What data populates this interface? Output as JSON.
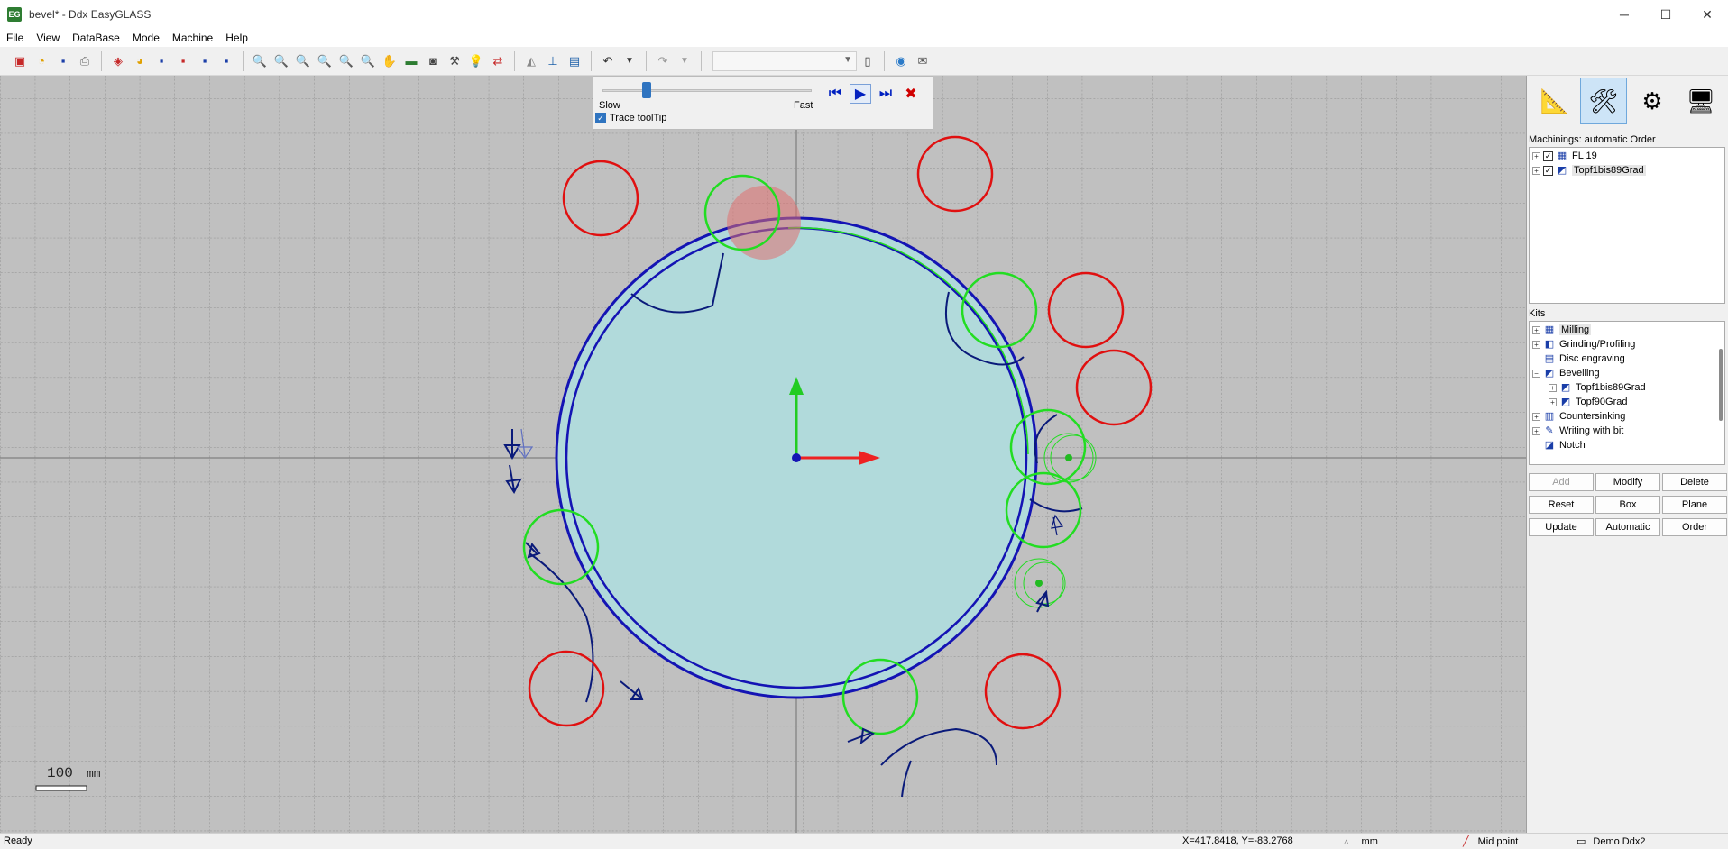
{
  "window": {
    "title": "bevel* - Ddx EasyGLASS",
    "app_icon": "easyglass-icon"
  },
  "menu": [
    "File",
    "View",
    "DataBase",
    "Mode",
    "Machine",
    "Help"
  ],
  "simulation": {
    "slow_label": "Slow",
    "fast_label": "Fast",
    "speed_fraction": 0.21,
    "trace_label": "Trace toolTip",
    "trace_checked": true
  },
  "canvas": {
    "scale_label": "100",
    "scale_unit": "mm",
    "colors": {
      "background": "#c0c0c0",
      "glass": "#b1dadb",
      "profile": "#1414b4",
      "tool_red": "#e01010",
      "tool_green": "#22dd22",
      "path": "#0a1a7a",
      "axis_x": "#ee2222",
      "axis_y": "#22cc22"
    }
  },
  "right_panel": {
    "machinings_label": "Machinings: automatic Order",
    "machinings": [
      {
        "label": "FL 19",
        "checked": true
      },
      {
        "label": "Topf1bis89Grad",
        "checked": true
      }
    ],
    "kits_label": "Kits",
    "kits": [
      {
        "label": "Milling",
        "level": 0,
        "expander": "+"
      },
      {
        "label": "Grinding/Profiling",
        "level": 0,
        "expander": "+"
      },
      {
        "label": "Disc engraving",
        "level": 0,
        "expander": ""
      },
      {
        "label": "Bevelling",
        "level": 0,
        "expander": "−"
      },
      {
        "label": "Topf1bis89Grad",
        "level": 1,
        "expander": "+"
      },
      {
        "label": "Topf90Grad",
        "level": 1,
        "expander": "+"
      },
      {
        "label": "Countersinking",
        "level": 0,
        "expander": "+"
      },
      {
        "label": "Writing with bit",
        "level": 0,
        "expander": "+"
      },
      {
        "label": "Notch",
        "level": 0,
        "expander": ""
      }
    ],
    "buttons": [
      "Add",
      "Modify",
      "Delete",
      "Reset",
      "Box",
      "Plane",
      "Update",
      "Automatic",
      "Order"
    ]
  },
  "status": {
    "ready": "Ready",
    "coords": "X=417.8418,  Y=-83.2768",
    "unit": "mm",
    "snap": "Mid point",
    "machine": "Demo Ddx2"
  }
}
